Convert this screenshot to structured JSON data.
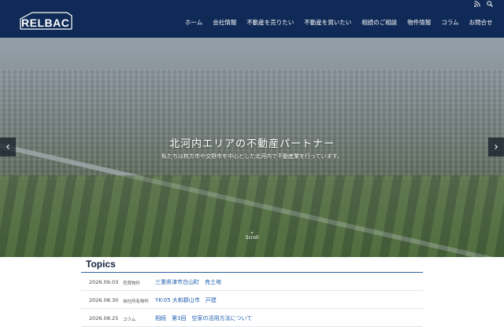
{
  "header": {
    "logo": "RELBAC",
    "nav": [
      "ホーム",
      "会社情報",
      "不動産を売りたい",
      "不動産を買いたい",
      "相続のご相談",
      "物件情報",
      "コラム",
      "お問合せ"
    ],
    "icons": [
      "rss-icon",
      "search-icon"
    ]
  },
  "hero": {
    "title": "北河内エリアの不動産パートナー",
    "subtitle": "私たちは枚方市や交野市を中心とした北河内で不動産業を行っています。",
    "scroll_label": "Scroll"
  },
  "topics": {
    "heading": "Topics",
    "items": [
      {
        "date": "2026.09.03",
        "category": "売買物件",
        "title": "三重県津市白山町　売土地"
      },
      {
        "date": "2026.08.30",
        "category": "自社所有物件",
        "title": "YK-05 大和郡山市　戸建"
      },
      {
        "date": "2026.08.25",
        "category": "コラム",
        "title": "相続　第3回　空家の活用方法について"
      }
    ]
  }
}
